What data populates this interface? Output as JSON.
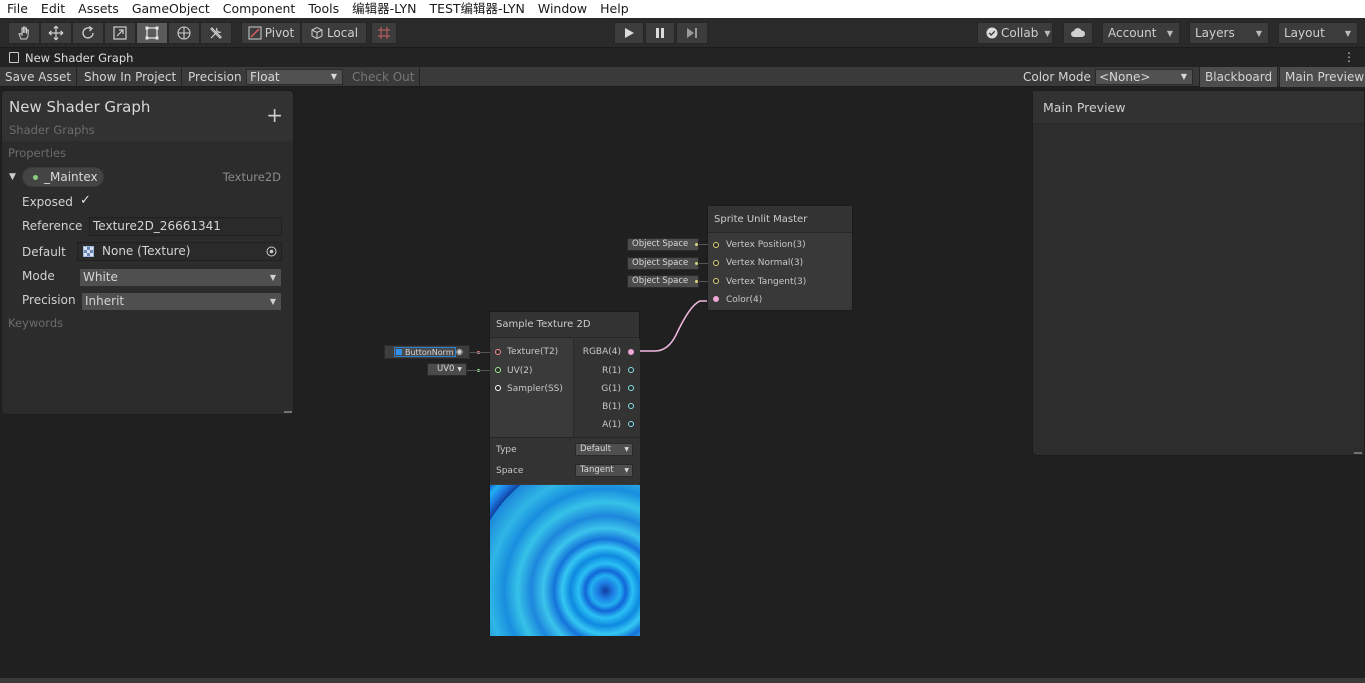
{
  "menu": [
    "File",
    "Edit",
    "Assets",
    "GameObject",
    "Component",
    "Tools",
    "编辑器-LYN",
    "TEST编辑器-LYN",
    "Window",
    "Help"
  ],
  "toolbar": {
    "pivot_label": "Pivot",
    "local_label": "Local",
    "collab_label": "Collab",
    "account_label": "Account",
    "layers_label": "Layers",
    "layout_label": "Layout"
  },
  "window_tab": {
    "title": "New Shader Graph"
  },
  "graph_toolbar": {
    "save_asset": "Save Asset",
    "show_in_project": "Show In Project",
    "precision_label": "Precision",
    "precision_value": "Float",
    "check_out": "Check Out",
    "color_mode_label": "Color Mode",
    "color_mode_value": "<None>",
    "blackboard": "Blackboard",
    "main_preview": "Main Preview"
  },
  "blackboard": {
    "title": "New Shader Graph",
    "subtitle": "Shader Graphs",
    "add": "+",
    "properties_header": "Properties",
    "property": {
      "name": "_Maintex",
      "type": "Texture2D",
      "exposed_label": "Exposed",
      "exposed_checked": true,
      "reference_label": "Reference",
      "reference_value": "Texture2D_26661341",
      "default_label": "Default",
      "default_value": "None (Texture)",
      "mode_label": "Mode",
      "mode_value": "White",
      "precision_label": "Precision",
      "precision_value": "Inherit"
    },
    "keywords_header": "Keywords"
  },
  "master_node": {
    "title": "Sprite Unlit Master",
    "inputs": [
      {
        "label": "Vertex Position(3)",
        "space": "Object Space"
      },
      {
        "label": "Vertex Normal(3)",
        "space": "Object Space"
      },
      {
        "label": "Vertex Tangent(3)",
        "space": "Object Space"
      },
      {
        "label": "Color(4)"
      }
    ]
  },
  "sample_node": {
    "title": "Sample Texture 2D",
    "inputs": [
      "Texture(T2)",
      "UV(2)",
      "Sampler(SS)"
    ],
    "outputs": [
      "RGBA(4)",
      "R(1)",
      "G(1)",
      "B(1)",
      "A(1)"
    ],
    "type_label": "Type",
    "type_value": "Default",
    "space_label": "Space",
    "space_value": "Tangent",
    "texture_input": "ButtonNorm",
    "uv_input": "UV0"
  },
  "main_preview_panel": {
    "title": "Main Preview"
  },
  "colors": {
    "port_vector3": "#d9d47a",
    "port_vector4": "#f0a8d8",
    "port_vector1": "#84e4e7",
    "port_texture": "#ff8b8b",
    "port_vector2": "#9aef92",
    "connection": "#f0b8e0"
  }
}
